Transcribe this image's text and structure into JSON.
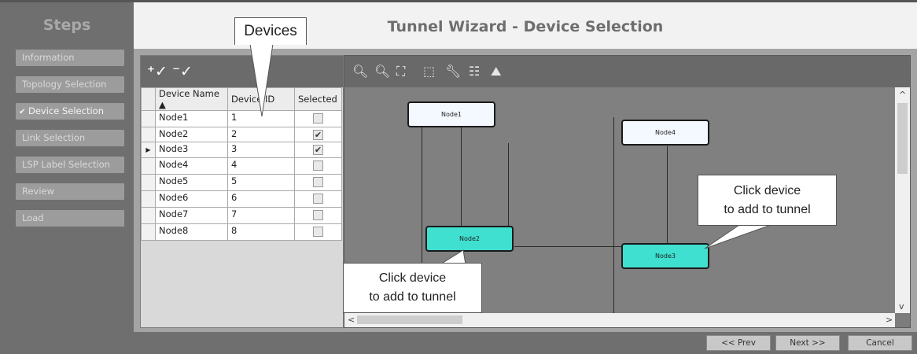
{
  "sidebar": {
    "title": "Steps",
    "steps": [
      {
        "label": "Information",
        "checked": false
      },
      {
        "label": "Topology Selection",
        "checked": false
      },
      {
        "label": "Device Selection",
        "checked": true
      },
      {
        "label": "Link Selection",
        "checked": false
      },
      {
        "label": "LSP Label Selection",
        "checked": false
      },
      {
        "label": "Review",
        "checked": false
      },
      {
        "label": "Load",
        "checked": false
      }
    ],
    "check_glyph": "✔"
  },
  "header": {
    "title": "Tunnel Wizard - Device Selection"
  },
  "table": {
    "columns": [
      "Device Name ▲",
      "Device ID",
      "Selected"
    ],
    "rows": [
      {
        "name": "Node1",
        "id": "1",
        "selected": false,
        "current": false
      },
      {
        "name": "Node2",
        "id": "2",
        "selected": true,
        "current": false
      },
      {
        "name": "Node3",
        "id": "3",
        "selected": true,
        "current": true
      },
      {
        "name": "Node4",
        "id": "4",
        "selected": false,
        "current": false
      },
      {
        "name": "Node5",
        "id": "5",
        "selected": false,
        "current": false
      },
      {
        "name": "Node6",
        "id": "6",
        "selected": false,
        "current": false
      },
      {
        "name": "Node7",
        "id": "7",
        "selected": false,
        "current": false
      },
      {
        "name": "Node8",
        "id": "8",
        "selected": false,
        "current": false
      }
    ],
    "current_row_glyph": "▶",
    "check_glyph": "✔",
    "toolbar_icons": [
      "add-selected-icon",
      "remove-selected-icon"
    ]
  },
  "topology": {
    "toolbar_icons": [
      "zoom-in-icon",
      "zoom-out-icon",
      "fit-view-icon",
      "select-icon",
      "wrench-icon",
      "hierarchy-layout-icon",
      "image-icon"
    ],
    "nodes": [
      {
        "label": "Node1",
        "selected": false
      },
      {
        "label": "Node4",
        "selected": false
      },
      {
        "label": "Node2",
        "selected": true
      },
      {
        "label": "Node3",
        "selected": true
      }
    ],
    "selected_color": "#3fe0d0",
    "unselected_color": "#f4f8ff"
  },
  "callouts": {
    "devices": "Devices",
    "click_right_1": "Click device",
    "click_right_2": "to add to tunnel",
    "click_bottom_1": "Click device",
    "click_bottom_2": "to add to tunnel"
  },
  "footer": {
    "prev": "<< Prev",
    "next": "Next >>",
    "cancel": "Cancel"
  }
}
